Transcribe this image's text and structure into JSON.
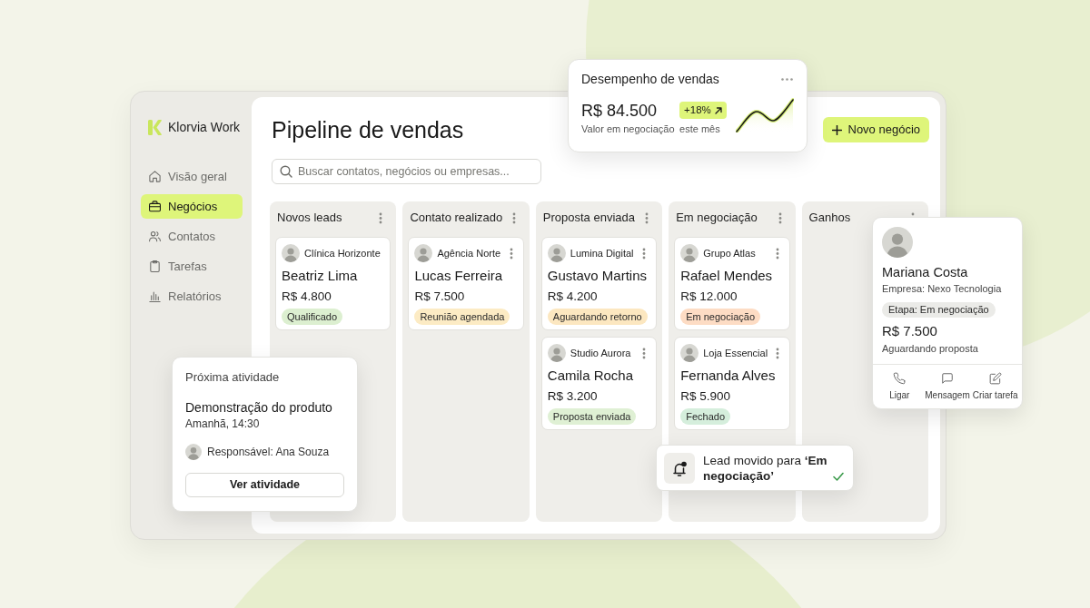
{
  "sidebar": {
    "brand": "Klorvia Work",
    "items": [
      {
        "label": "Visão geral",
        "selected": false
      },
      {
        "label": "Negócios",
        "selected": true
      },
      {
        "label": "Contatos",
        "selected": false
      },
      {
        "label": "Tarefas",
        "selected": false
      },
      {
        "label": "Relatórios",
        "selected": false
      }
    ]
  },
  "header": {
    "title": "Pipeline de vendas",
    "search": {
      "placeholder": "Buscar contatos, negócios ou empresas..."
    },
    "new_button": "Novo negócio"
  },
  "columns": [
    {
      "title": "Novos leads",
      "cards": [
        {
          "company": "Clínica Horizonte",
          "name": "Beatriz Lima",
          "amount": "R$ 4.800",
          "menu": false,
          "tag": {
            "label": "Qualificado",
            "color": "#dcefd0"
          }
        }
      ]
    },
    {
      "title": "Contato realizado",
      "cards": [
        {
          "company": "Agência Norte",
          "name": "Lucas Ferreira",
          "amount": "R$ 7.500",
          "menu": true,
          "tag": {
            "label": "Reunião agendada",
            "color": "#fcebc4"
          }
        }
      ]
    },
    {
      "title": "Proposta enviada",
      "cards": [
        {
          "company": "Lumina Digital",
          "name": "Gustavo Martins",
          "amount": "R$ 4.200",
          "menu": true,
          "tag": {
            "label": "Aguardando retorno",
            "color": "#fce7c0"
          }
        },
        {
          "company": "Studio Aurora",
          "name": "Camila Rocha",
          "amount": "R$ 3.200",
          "menu": true,
          "tag": {
            "label": "Proposta enviada",
            "color": "#dff0d4"
          }
        }
      ]
    },
    {
      "title": "Em negociação",
      "cards": [
        {
          "company": "Grupo Atlas",
          "name": "Rafael Mendes",
          "amount": "R$ 12.000",
          "menu": true,
          "tag": {
            "label": "Em negociação",
            "color": "#fddcc4"
          }
        },
        {
          "company": "Loja Essencial",
          "name": "Fernanda Alves",
          "amount": "R$ 5.900",
          "menu": true,
          "tag": {
            "label": "Fechado",
            "color": "#d5eedc"
          }
        }
      ]
    },
    {
      "title": "Ganhos"
    }
  ],
  "sales_card": {
    "title": "Desempenho de vendas",
    "value": "R$ 84.500",
    "value_label": "Valor em negociação",
    "change": "+18%",
    "change_label": "este mês"
  },
  "contact_card": {
    "name": "Mariana Costa",
    "company": "Empresa: Nexo Tecnologia",
    "stage": "Etapa: Em negociação",
    "amount": "R$ 7.500",
    "status": "Aguardando proposta",
    "actions": [
      "Ligar",
      "Mensagem",
      "Criar tarefa"
    ]
  },
  "activity_card": {
    "heading": "Próxima atividade",
    "title": "Demonstração do produto",
    "time": "Amanhã, 14:30",
    "owner": "Responsável: Ana Souza",
    "button": "Ver atividade"
  },
  "toast": {
    "message": "Lead movido para **‘Em negociação’**"
  }
}
